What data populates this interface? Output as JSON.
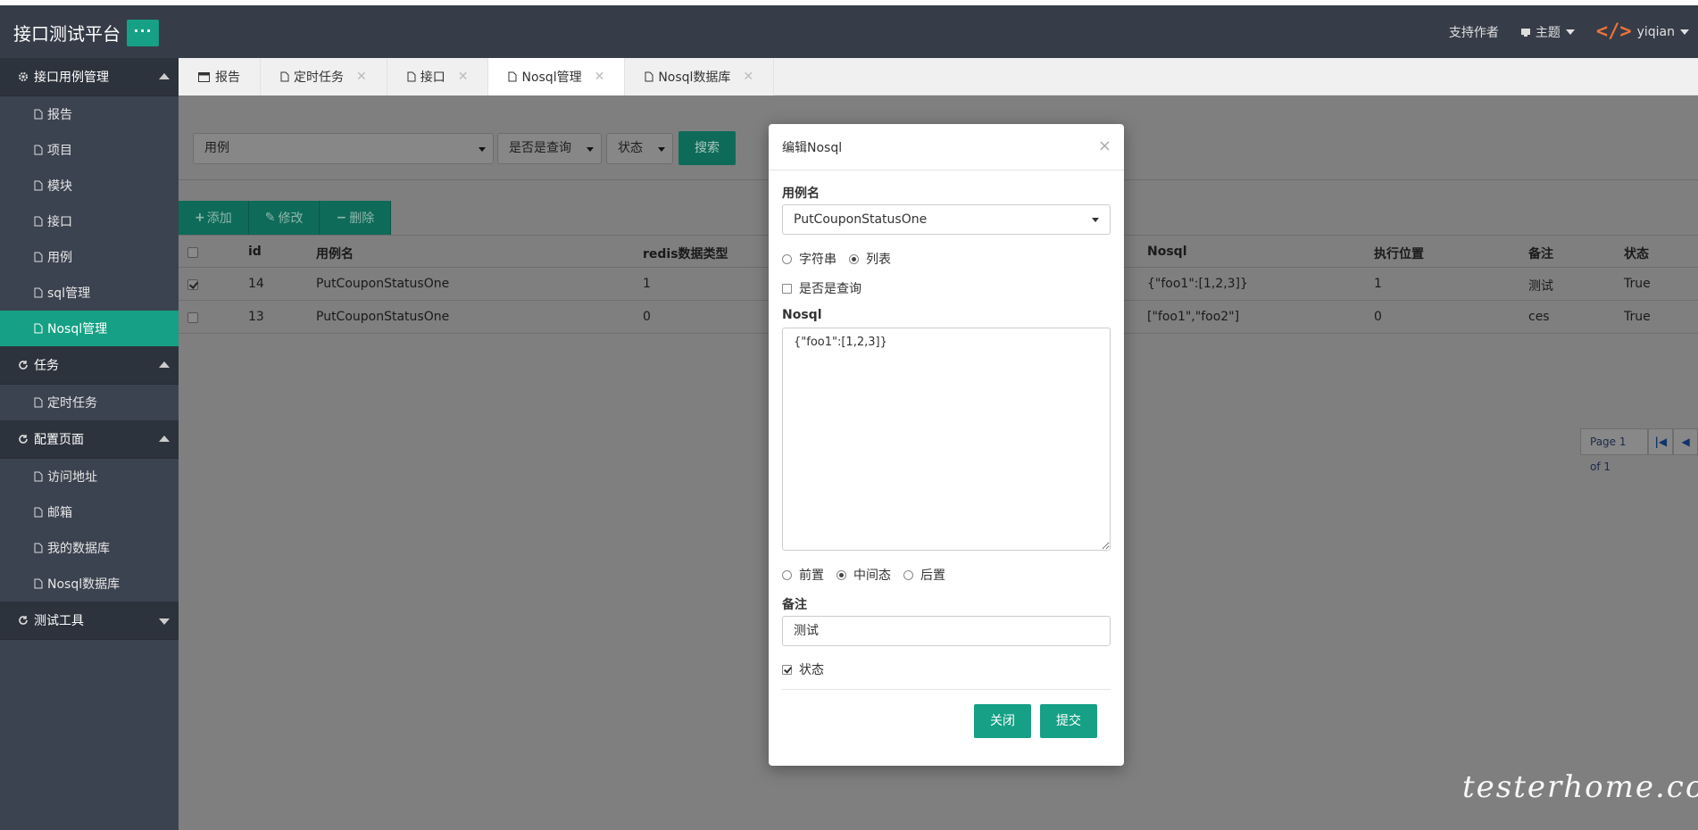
{
  "header": {
    "brand": "接口测试平台",
    "menu_button": "···",
    "support": "支持作者",
    "theme": "主题",
    "user": "yiqian"
  },
  "sidebar": {
    "groups": [
      {
        "label": "接口用例管理",
        "items": [
          "报告",
          "项目",
          "模块",
          "接口",
          "用例",
          "sql管理",
          "Nosql管理"
        ]
      },
      {
        "label": "任务",
        "items": [
          "定时任务"
        ]
      },
      {
        "label": "配置页面",
        "items": [
          "访问地址",
          "邮箱",
          "我的数据库",
          "Nosql数据库"
        ]
      },
      {
        "label": "测试工具",
        "items": []
      }
    ],
    "active": "Nosql管理"
  },
  "tabs": [
    {
      "label": "报告",
      "closable": false
    },
    {
      "label": "定时任务",
      "closable": true
    },
    {
      "label": "接口",
      "closable": true
    },
    {
      "label": "Nosql管理",
      "closable": true,
      "active": true
    },
    {
      "label": "Nosql数据库",
      "closable": true
    }
  ],
  "filters": {
    "case": "用例",
    "is_query": "是否是查询",
    "status": "状态",
    "search": "搜索"
  },
  "actions": {
    "add": "添加",
    "edit": "修改",
    "delete": "删除"
  },
  "table": {
    "columns": [
      "id",
      "用例名",
      "redis数据类型",
      "Nosql",
      "执行位置",
      "备注",
      "状态"
    ],
    "rows": [
      {
        "checked": true,
        "id": "14",
        "name": "PutCouponStatusOne",
        "type": "1",
        "nosql": "{\"foo1\":[1,2,3]}",
        "pos": "1",
        "remark": "测试",
        "status": "True"
      },
      {
        "checked": false,
        "id": "13",
        "name": "PutCouponStatusOne",
        "type": "0",
        "nosql": "[\"foo1\",\"foo2\"]",
        "pos": "0",
        "remark": "ces",
        "status": "True"
      }
    ]
  },
  "pager": {
    "text": "Page 1 of 1"
  },
  "modal": {
    "title": "编辑Nosql",
    "close": "×",
    "case_label": "用例名",
    "case_value": "PutCouponStatusOne",
    "type_string": "字符串",
    "type_list": "列表",
    "is_query": "是否是查询",
    "nosql_label": "Nosql",
    "nosql_value": "{\"foo1\":[1,2,3]}",
    "pos_before": "前置",
    "pos_middle": "中间态",
    "pos_after": "后置",
    "remark_label": "备注",
    "remark_value": "测试",
    "status_label": "状态",
    "close_btn": "关闭",
    "submit_btn": "提交"
  },
  "watermark": "testerhome.com"
}
